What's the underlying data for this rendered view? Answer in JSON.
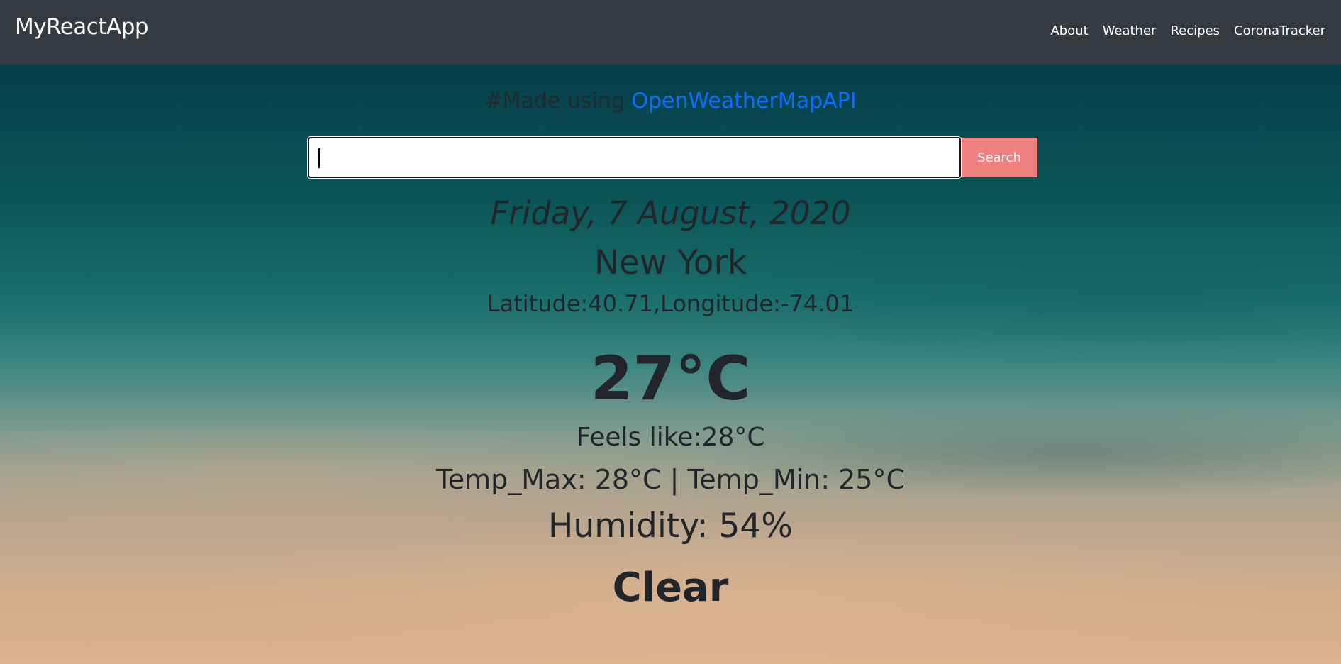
{
  "navbar": {
    "brand": "MyReactApp",
    "links": [
      "About",
      "Weather",
      "Recipes",
      "CoronaTracker"
    ]
  },
  "header": {
    "made_prefix": "#Made using ",
    "api_name": "OpenWeatherMapAPI"
  },
  "search": {
    "value": "",
    "button_label": "Search"
  },
  "weather": {
    "date": "Friday, 7 August, 2020",
    "city": "New York",
    "coordinates": "Latitude:40.71,Longitude:-74.01",
    "temperature": "27°C",
    "feels_like": "Feels like:28°C",
    "min_max": "Temp_Max: 28°C | Temp_Min: 25°C",
    "humidity": "Humidity: 54%",
    "description": "Clear"
  },
  "colors": {
    "navbar_bg": "#343a40",
    "link_blue": "#0d6efd",
    "search_button_bg": "#f07f80",
    "text_dark": "#22262b"
  }
}
